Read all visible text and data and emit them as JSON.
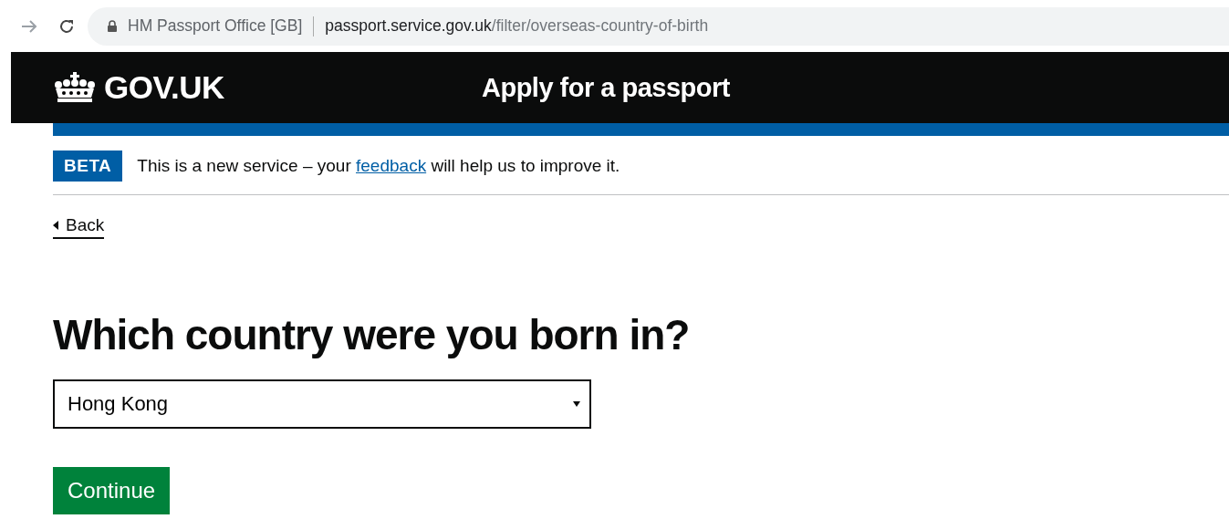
{
  "browser": {
    "site_name": "HM Passport Office [GB]",
    "url": {
      "host": "passport.service.gov.uk",
      "path": "/filter/overseas-country-of-birth"
    }
  },
  "header": {
    "logo": "GOV.UK",
    "service_name": "Apply for a passport"
  },
  "phase_banner": {
    "tag": "BETA",
    "text_before": "This is a new service – your ",
    "link": "feedback",
    "text_after": " will help us to improve it."
  },
  "back_link": "Back",
  "question": {
    "heading": "Which country were you born in?",
    "select": {
      "value": "Hong Kong"
    }
  },
  "buttons": [
    "Continue"
  ]
}
